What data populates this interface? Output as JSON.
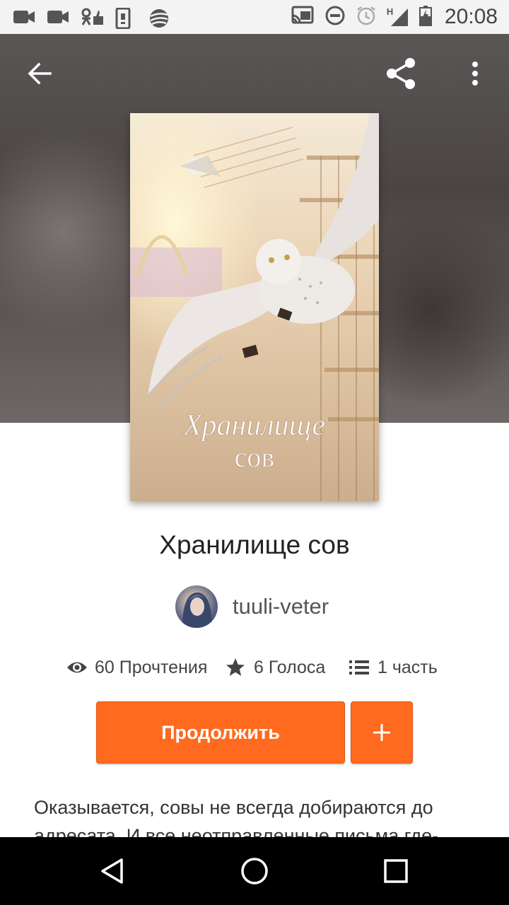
{
  "status_bar": {
    "time": "20:08",
    "network_label": "H",
    "left_icons": [
      "video-camera-icon",
      "video-camera-icon",
      "odnoklassniki-icon",
      "phone-vibrate-icon",
      "beeline-icon"
    ],
    "right_icons": [
      "cast-icon",
      "do-not-disturb-icon",
      "alarm-icon",
      "signal-icon",
      "battery-charging-icon"
    ]
  },
  "toolbar": {
    "back_icon": "arrow-left-icon",
    "share_icon": "share-icon",
    "menu_icon": "more-vertical-icon"
  },
  "cover": {
    "title_line1": "Хранилище",
    "title_line2": "сов"
  },
  "story": {
    "title": "Хранилище сов",
    "author": "tuuli-veter",
    "stats": {
      "reads": "60 Прочтения",
      "votes": "6 Голоса",
      "parts": "1 часть"
    },
    "description_line1": "Оказывается, совы не всегда добираются до",
    "description_line2": "адресата. И все неотправленные письма где-"
  },
  "actions": {
    "continue_label": "Продолжить",
    "add_label": "+"
  },
  "nav": {
    "back_icon": "triangle-back-icon",
    "home_icon": "circle-home-icon",
    "recents_icon": "square-recents-icon"
  },
  "colors": {
    "accent": "#ff6a1e",
    "nav_bar": "#000000",
    "status_bar": "#f3f3f3"
  }
}
